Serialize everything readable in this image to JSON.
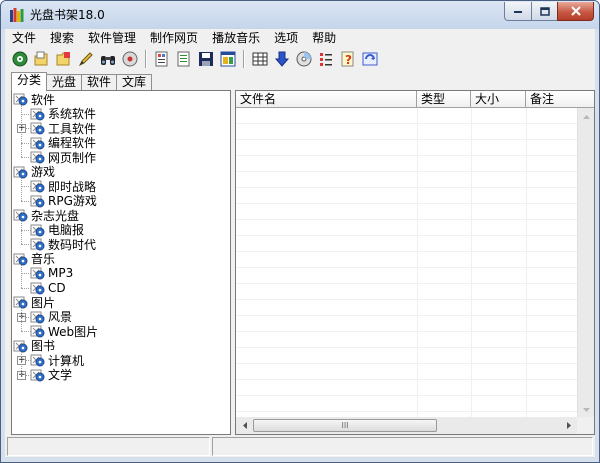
{
  "window": {
    "title": "光盘书架18.0"
  },
  "menu": [
    "文件",
    "搜索",
    "软件管理",
    "制作网页",
    "播放音乐",
    "选项",
    "帮助"
  ],
  "toolbar": {
    "buttons": [
      {
        "name": "disc-icon"
      },
      {
        "name": "new-folder-icon"
      },
      {
        "name": "open-folder-icon"
      },
      {
        "name": "edit-icon"
      },
      {
        "name": "binoculars-icon"
      },
      {
        "name": "disc-search-icon"
      },
      {
        "sep": true
      },
      {
        "name": "properties-icon"
      },
      {
        "name": "document-icon"
      },
      {
        "name": "save-icon"
      },
      {
        "name": "web-page-icon"
      },
      {
        "sep": true
      },
      {
        "name": "table-icon"
      },
      {
        "name": "download-arrow-icon"
      },
      {
        "name": "cd-icon"
      },
      {
        "name": "list-check-icon"
      },
      {
        "name": "help-icon"
      },
      {
        "name": "refresh-icon"
      }
    ]
  },
  "tabs": [
    "分类",
    "光盘",
    "软件",
    "文库"
  ],
  "tree": [
    {
      "label": "软件",
      "level": 0
    },
    {
      "label": "系统软件",
      "level": 1
    },
    {
      "label": "工具软件",
      "level": 1,
      "expandable": true
    },
    {
      "label": "编程软件",
      "level": 1
    },
    {
      "label": "网页制作",
      "level": 1
    },
    {
      "label": "游戏",
      "level": 0
    },
    {
      "label": "即时战略",
      "level": 1
    },
    {
      "label": "RPG游戏",
      "level": 1
    },
    {
      "label": "杂志光盘",
      "level": 0
    },
    {
      "label": "电脑报",
      "level": 1
    },
    {
      "label": "数码时代",
      "level": 1
    },
    {
      "label": "音乐",
      "level": 0
    },
    {
      "label": "MP3",
      "level": 1
    },
    {
      "label": "CD",
      "level": 1
    },
    {
      "label": "图片",
      "level": 0
    },
    {
      "label": "风景",
      "level": 1,
      "expandable": true
    },
    {
      "label": "Web图片",
      "level": 1
    },
    {
      "label": "图书",
      "level": 0
    },
    {
      "label": "计算机",
      "level": 1,
      "expandable": true
    },
    {
      "label": "文学",
      "level": 1,
      "expandable": true
    }
  ],
  "list": {
    "columns": [
      "文件名",
      "类型",
      "大小",
      "备注"
    ]
  },
  "scroll": {
    "thumb_glyph": "III"
  },
  "colors": {
    "tree_icon_blue": "#2f6fc9",
    "tree_icon_gray": "#8a8a8a",
    "close_red": "#c75a45"
  }
}
